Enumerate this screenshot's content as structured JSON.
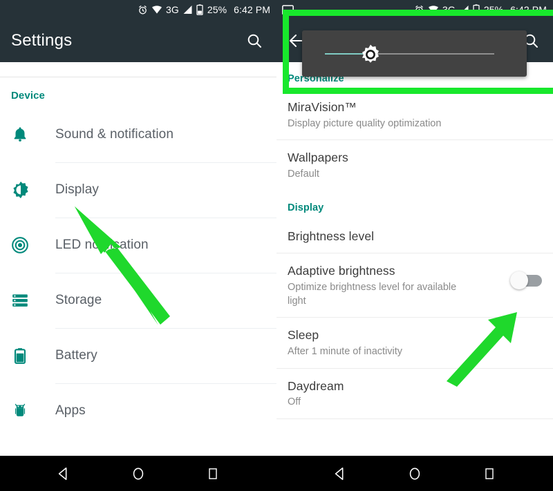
{
  "status_bar": {
    "alarm_icon": "alarm-clock-icon",
    "wifi_icon": "wifi-icon",
    "network_label": "3G",
    "signal_icon": "cellular-signal-icon",
    "battery_icon": "battery-icon",
    "battery_percent": "25%",
    "time": "6:42 PM",
    "screenshot_icon": "screenshot-image-icon"
  },
  "left_panel": {
    "toolbar": {
      "title": "Settings",
      "search_icon": "search-icon"
    },
    "section_label": "Device",
    "items": [
      {
        "label": "Sound & notification",
        "icon": "bell-icon"
      },
      {
        "label": "Display",
        "icon": "brightness-icon"
      },
      {
        "label": "LED notification",
        "icon": "led-target-icon"
      },
      {
        "label": "Storage",
        "icon": "storage-icon"
      },
      {
        "label": "Battery",
        "icon": "battery-icon"
      },
      {
        "label": "Apps",
        "icon": "android-robot-icon"
      }
    ]
  },
  "right_panel": {
    "toolbar": {
      "back_icon": "back-arrow-icon",
      "search_icon": "search-icon"
    },
    "brightness_popup": {
      "slider_icon": "brightness-sun-thumb-icon",
      "slider_value_percent": 27
    },
    "sections": [
      {
        "label": "Personalize",
        "items": [
          {
            "title": "MiraVision™",
            "subtitle": "Display picture quality optimization"
          },
          {
            "title": "Wallpapers",
            "subtitle": "Default"
          }
        ]
      },
      {
        "label": "Display",
        "items": [
          {
            "title": "Brightness level",
            "subtitle": ""
          },
          {
            "title": "Adaptive brightness",
            "subtitle": "Optimize brightness level for available light",
            "toggle": "off"
          },
          {
            "title": "Sleep",
            "subtitle": "After 1 minute of inactivity"
          },
          {
            "title": "Daydream",
            "subtitle": "Off"
          }
        ]
      }
    ]
  },
  "nav_bar": {
    "back_icon": "nav-back-triangle-icon",
    "home_icon": "nav-home-circle-icon",
    "recents_icon": "nav-recents-square-icon"
  },
  "annotations": {
    "highlight_color": "#18e82c",
    "arrow_color": "#1fd82c",
    "arrows": [
      {
        "name": "arrow-to-display-item",
        "points_to": "Display"
      },
      {
        "name": "arrow-to-adaptive-brightness-toggle",
        "points_to": "Adaptive brightness toggle"
      }
    ]
  },
  "theme": {
    "toolbar_bg": "#263238",
    "accent_teal": "#00897b",
    "popup_bg": "#424242",
    "slider_fill": "#80cbc4"
  }
}
